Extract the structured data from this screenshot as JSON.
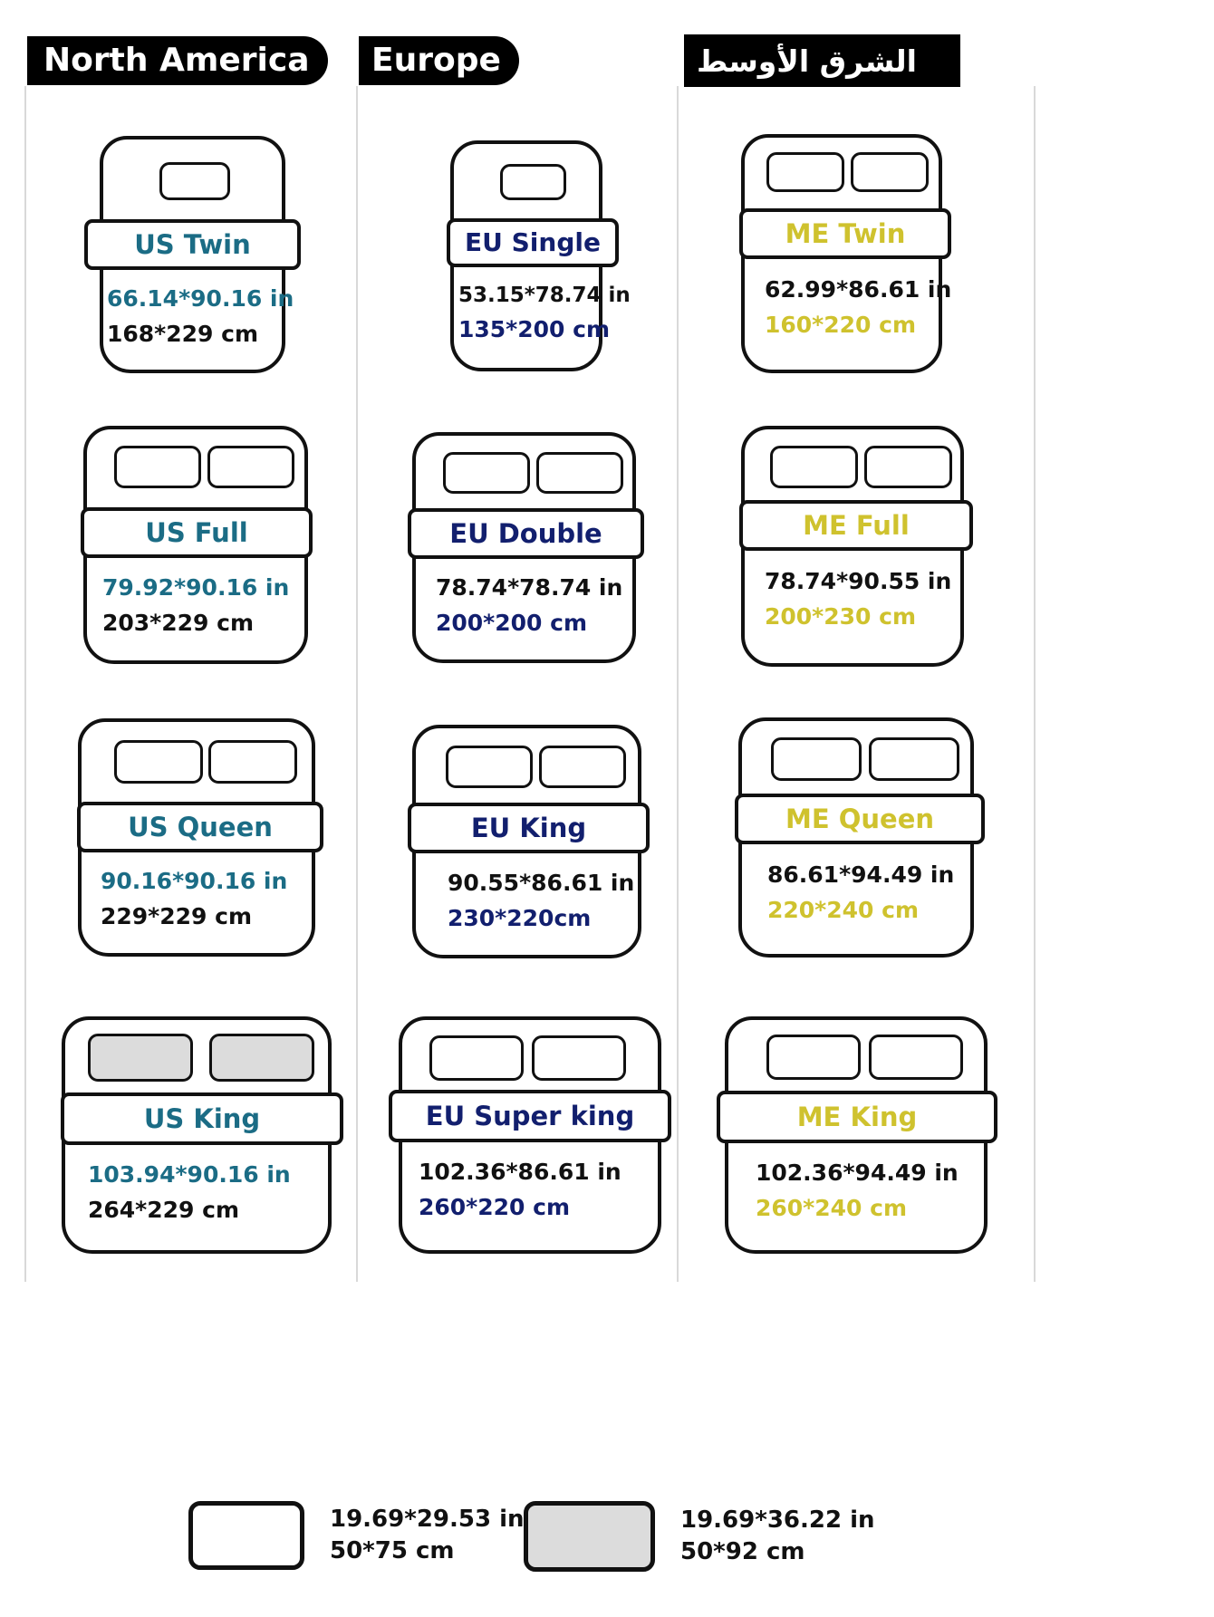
{
  "title": "Bed Size Comparison Chart",
  "regions": [
    {
      "id": "north-america",
      "header": "North America",
      "colors": {
        "title": "#1b6c85",
        "inches": "#1b6c85",
        "cm": "#111111"
      },
      "beds": [
        {
          "name": "US Twin",
          "inches": "66.14*90.16 in",
          "cm": "168*229 cm",
          "pillows": 1,
          "pillow_fill": "white"
        },
        {
          "name": "US Full",
          "inches": "79.92*90.16 in",
          "cm": "203*229 cm",
          "pillows": 2,
          "pillow_fill": "white"
        },
        {
          "name": "US Queen",
          "inches": "90.16*90.16 in",
          "cm": "229*229 cm",
          "pillows": 2,
          "pillow_fill": "white"
        },
        {
          "name": "US King",
          "inches": "103.94*90.16 in",
          "cm": "264*229 cm",
          "pillows": 2,
          "pillow_fill": "gray"
        }
      ]
    },
    {
      "id": "europe",
      "header": "Europe",
      "colors": {
        "title": "#121f6e",
        "inches": "#111111",
        "cm": "#121f6e"
      },
      "beds": [
        {
          "name": "EU Single",
          "inches": "53.15*78.74 in",
          "cm": "135*200 cm",
          "pillows": 1,
          "pillow_fill": "white"
        },
        {
          "name": "EU Double",
          "inches": "78.74*78.74 in",
          "cm": "200*200 cm",
          "pillows": 2,
          "pillow_fill": "white"
        },
        {
          "name": "EU King",
          "inches": "90.55*86.61 in",
          "cm": "230*220cm",
          "pillows": 2,
          "pillow_fill": "white"
        },
        {
          "name": "EU Super king",
          "inches": "102.36*86.61 in",
          "cm": "260*220 cm",
          "pillows": 2,
          "pillow_fill": "white"
        }
      ]
    },
    {
      "id": "middle-east",
      "header": "الشرق الأوسط",
      "colors": {
        "title": "#cfc22e",
        "inches": "#111111",
        "cm": "#cfc22e"
      },
      "beds": [
        {
          "name": "ME Twin",
          "inches": "62.99*86.61 in",
          "cm": "160*220 cm",
          "pillows": 2,
          "pillow_fill": "white"
        },
        {
          "name": "ME Full",
          "inches": "78.74*90.55 in",
          "cm": "200*230 cm",
          "pillows": 2,
          "pillow_fill": "white"
        },
        {
          "name": "ME Queen",
          "inches": "86.61*94.49 in",
          "cm": "220*240 cm",
          "pillows": 2,
          "pillow_fill": "white"
        },
        {
          "name": "ME King",
          "inches": "102.36*94.49 in",
          "cm": "260*240 cm",
          "pillows": 2,
          "pillow_fill": "white"
        }
      ]
    }
  ],
  "legend": [
    {
      "swatch": "white",
      "inches": "19.69*29.53 in",
      "cm": "50*75 cm"
    },
    {
      "swatch": "gray",
      "inches": "19.69*36.22 in",
      "cm": "50*92 cm"
    }
  ]
}
